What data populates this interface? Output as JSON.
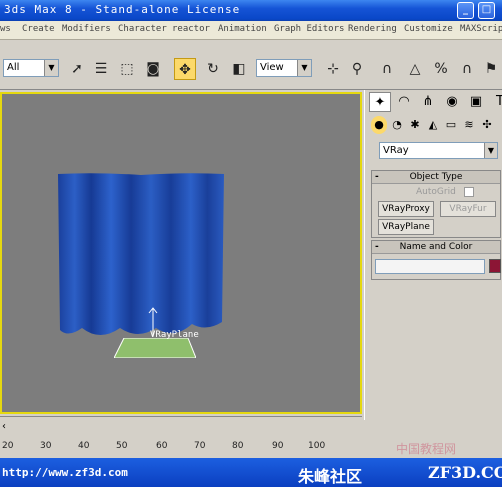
{
  "window": {
    "title": "3ds Max 8  -  Stand-alone License"
  },
  "menu": [
    "ws",
    "Create",
    "Modifiers",
    "Character",
    "reactor",
    "Animation",
    "Graph Editors",
    "Rendering",
    "Customize",
    "MAXScript"
  ],
  "toolbar": {
    "selection_filter": "All",
    "ref_coord": "View"
  },
  "viewport": {
    "object_label": "VRayPlane"
  },
  "command_panel": {
    "category_dropdown": "VRay",
    "object_type": {
      "header": "Object Type",
      "autogrid_label": "AutoGrid",
      "buttons": [
        "VRayProxy",
        "VRayFur",
        "VRayPlane"
      ]
    },
    "name_color": {
      "header": "Name and Color",
      "name_value": "",
      "color": "#8c1535"
    }
  },
  "timeline": {
    "ticks": [
      "20",
      "30",
      "40",
      "50",
      "60",
      "70",
      "80",
      "90",
      "100"
    ]
  },
  "footer": {
    "url": "http://www.zf3d.com",
    "brand": "朱峰社区",
    "brand2": "ZF3D.COM",
    "watermark": "中国教程网"
  }
}
